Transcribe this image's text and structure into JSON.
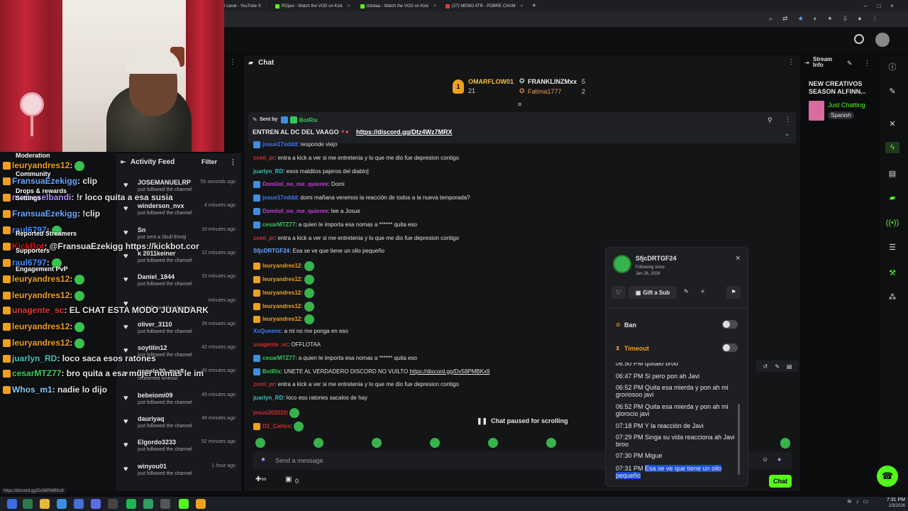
{
  "browser": {
    "tabs": [
      {
        "label": "l canal - YouTube S"
      },
      {
        "label": "RDjavi - Watch the VOD on Kick"
      },
      {
        "label": "itzlotaa - Watch the VOD on Kick"
      },
      {
        "label": "(27) MEMO ATR - POBRE CHAM"
      }
    ],
    "status_url": "https://discord.gg/Dv58PMBKx9"
  },
  "overlay_chat": {
    "menu": [
      "Moderation",
      "Community",
      "Drops & rewards",
      "Settings",
      "Reported Streamers",
      "Supporters",
      "Engagement PvP"
    ],
    "lines": [
      {
        "user": "leuryandres12",
        "text": ":",
        "color": "#f0a020"
      },
      {
        "user": "FransuaEzekigg",
        "text": ": clip",
        "color": "#6aa8ff"
      },
      {
        "user": "moiseselbandi",
        "text": ": !r loco quita a esa susia",
        "color": "#b58cff"
      },
      {
        "user": "FransuaEzekigg",
        "text": ": !clip",
        "color": "#6aa8ff"
      },
      {
        "user": "raul6797",
        "text": ":",
        "color": "#4a8cff"
      },
      {
        "user": "KickBot",
        "text": ": @FransuaEzekigg https://kickbot.cor",
        "color": "#d11"
      },
      {
        "user": "raul6797",
        "text": ":",
        "color": "#4a8cff"
      },
      {
        "user": "leuryandres12",
        "text": ":",
        "color": "#f0a020"
      },
      {
        "user": "leuryandres12",
        "text": ":",
        "color": "#f0a020"
      },
      {
        "user": "unagente_sc",
        "text": ": EL CHAT ESTA MODO JUANDARK",
        "color": "#e53935"
      },
      {
        "user": "leuryandres12",
        "text": ":",
        "color": "#f0a020"
      },
      {
        "user": "leuryandres12",
        "text": ":",
        "color": "#f0a020"
      },
      {
        "user": "juarlyn_RD",
        "text": ": loco saca esos ratones",
        "color": "#43c6c0"
      },
      {
        "user": "cesarMTZ77",
        "text": ": bro quita a esa mujer nomas le im",
        "color": "#38d05a"
      },
      {
        "user": "Whos_m1",
        "text": ": nadie lo dijo",
        "color": "#7fd0ff"
      }
    ]
  },
  "activity_feed": {
    "title": "Activity Feed",
    "filter": "Filter",
    "items": [
      {
        "name": "JOSEMANUELRP",
        "sub": "just followed the channel",
        "time": "55 seconds ago"
      },
      {
        "name": "winderson_nvx",
        "sub": "just followed the channel",
        "time": "4 minutes ago"
      },
      {
        "name": "Sn",
        "sub": "just sent a Skull Emoji",
        "time": "10 minutes ago"
      },
      {
        "name": "k 2011keiner",
        "sub": "just followed the channel",
        "time": "12 minutes ago"
      },
      {
        "name": "Daniel_1844",
        "sub": "just followed the channel",
        "time": "15 minutes ago"
      },
      {
        "name": "",
        "sub": "just followed the channel",
        "time": "minutes ago"
      },
      {
        "name": "oliver_3110",
        "sub": "just followed the channel",
        "time": "28 minutes ago"
      },
      {
        "name": "soytilin12",
        "sub": "just followed the channel",
        "time": "42 minutes ago"
      },
      {
        "name": "papolo20_nvx8",
        "sub": "redeemed timeout",
        "time": "45 minutes ago"
      },
      {
        "name": "bebeiomi09",
        "sub": "just followed the channel",
        "time": "49 minutes ago"
      },
      {
        "name": "dauriyaq",
        "sub": "just followed the channel",
        "time": "49 minutes ago"
      },
      {
        "name": "Elgordo3233",
        "sub": "just followed the channel",
        "time": "52 minutes ago"
      },
      {
        "name": "winyou01",
        "sub": "just followed the channel",
        "time": "1 hour ago"
      }
    ]
  },
  "chat": {
    "title": "Chat",
    "leaderboard": [
      {
        "name": "OMARFLOW01",
        "value": "21"
      },
      {
        "name": "FRANKLINZMxx",
        "value": "5"
      },
      {
        "name": "Fatima1777",
        "value": "2"
      }
    ],
    "pinned": {
      "sent_by_label": "Sent by",
      "sender": "BotRix",
      "text": "ENTREN AL DC DEL VAAGO",
      "link": "https://discord.gg/Dtz4Wz7MRX"
    },
    "messages": [
      {
        "user": "josue17xddd",
        "text": ": responde viejo",
        "color": "#3f7bff"
      },
      {
        "user": "zxml_pr",
        "text": ": entra a kick a ver si me entretenia y lo que me dio fue depresion contigo",
        "color": "#d62b2b"
      },
      {
        "user": "juarlyn_RD",
        "text": ": esos malditos pajeros del diablo]",
        "color": "#3fbfbb"
      },
      {
        "user": "Domiiol_no_me_quieree",
        "text": ": Domi",
        "color": "#c53fd8"
      },
      {
        "user": "josue17xddd",
        "text": ": domi mañana veremos la reacción de todos a la nueva temporada?",
        "color": "#3f7bff"
      },
      {
        "user": "Domiiol_no_me_quieree",
        "text": ": lee a Josue",
        "color": "#c53fd8"
      },
      {
        "user": "cesarMTZ77",
        "text": ": a quien le importa esa nomas a ****** quita eso",
        "color": "#34c85a"
      },
      {
        "user": "zxml_pr",
        "text": ": entra a kick a ver si me entretenia y lo que me dio fue depresion contigo",
        "color": "#d62b2b"
      },
      {
        "user": "SfjcDRTGF24",
        "text": ": Esa se ve que tiene un ollo pequeño",
        "color": "#6aa8ff"
      },
      {
        "user": "leuryandres12",
        "text": ":",
        "color": "#f0a020"
      },
      {
        "user": "leuryandres12",
        "text": ":",
        "color": "#f0a020"
      },
      {
        "user": "leuryandres12",
        "text": ":",
        "color": "#f0a020"
      },
      {
        "user": "leuryandres12",
        "text": ":",
        "color": "#f0a020"
      },
      {
        "user": "leuryandres12",
        "text": ":",
        "color": "#f0a020"
      },
      {
        "user": "XxQueenx",
        "text": ": a mi no me ponga en eso",
        "color": "#3f7bff"
      },
      {
        "user": "unagente_sc",
        "text": ": OFFLOTAA",
        "color": "#d62b2b"
      },
      {
        "user": "cesarMTZ77",
        "text": ": a quien le importa esa nomas a ****** quita eso",
        "color": "#34c85a"
      },
      {
        "user": "BotRix",
        "text": ": UNETE AL VERDADERO DISCORD NO VUILTO ",
        "color": "#34c85a",
        "link": "https://discord.gg/Dv58PMBKx9"
      },
      {
        "user": "zxml_pr",
        "text": ": entra a kick a ver si me entretenia y lo que me dio fue depresion contigo",
        "color": "#d62b2b"
      },
      {
        "user": "juarlyn_RD",
        "text": ": loco eso ratones sacalos de hay",
        "color": "#3fbfbb"
      },
      {
        "user": "jesus202020",
        "text": ":",
        "color": "#d62b2b"
      },
      {
        "user": "D1_Carlos",
        "text": ":",
        "color": "#d62b2b"
      }
    ],
    "paused": "Chat paused for scrolling",
    "composer_placeholder": "Send a message",
    "points": "0",
    "chat_button": "Chat"
  },
  "user_card": {
    "username": "SfjcDRTGF24",
    "following_since_label": "Following since",
    "following_since": "Jan 26, 2026",
    "gift_sub": "Gift a Sub",
    "ban": "Ban",
    "timeout": "Timeout",
    "log": [
      {
        "time": "06:50 PM",
        "text": "quitalo broo"
      },
      {
        "time": "06:47 PM",
        "text": "Si pero pon ah Javi"
      },
      {
        "time": "06:52 PM",
        "text": "Quita esa mierda y pon ah mi groriosoo javi"
      },
      {
        "time": "06:52 PM",
        "text": "Quita esa mierda y pon ah mi glorocio javi"
      },
      {
        "time": "07:18 PM",
        "text": "Y la reacción de Javi"
      },
      {
        "time": "07:29 PM",
        "text": "Singa su vida reacciona ah Javi broo"
      },
      {
        "time": "07:30 PM",
        "text": "Migue"
      },
      {
        "time": "07:31 PM",
        "text": "Esa se ve que tiene un ollo pequeño"
      }
    ]
  },
  "stream_info": {
    "label": "Stream Info",
    "title": "NEW CREATIVOS SEASON ALFINN...",
    "category": "Just Chatting",
    "language": "Spanish"
  },
  "taskbar": {
    "time": "7:31 PM",
    "date": "2/3/2026"
  },
  "colors": {
    "kick_green": "#53fc18",
    "panel": "#141517",
    "card": "#1d1f22"
  }
}
